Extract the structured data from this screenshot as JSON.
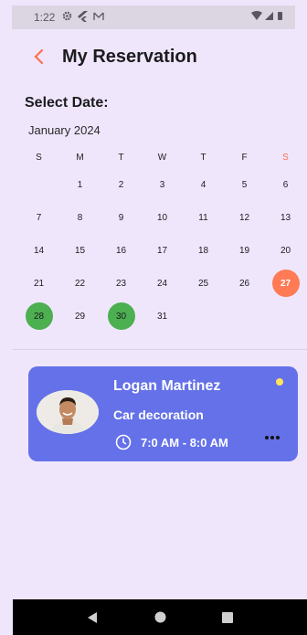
{
  "status_bar": {
    "time": "1:22",
    "icons": [
      "gear-icon",
      "flutter-icon",
      "mail-icon"
    ],
    "right_icons": [
      "wifi-icon",
      "signal-icon",
      "battery-icon"
    ]
  },
  "header": {
    "title": "My Reservation"
  },
  "calendar": {
    "label": "Select Date:",
    "month": "January 2024",
    "weekdays": [
      "S",
      "M",
      "T",
      "W",
      "T",
      "F",
      "S"
    ],
    "weeks": [
      [
        "",
        "1",
        "2",
        "3",
        "4",
        "5",
        "6"
      ],
      [
        "7",
        "8",
        "9",
        "10",
        "11",
        "12",
        "13"
      ],
      [
        "14",
        "15",
        "16",
        "17",
        "18",
        "19",
        "20"
      ],
      [
        "21",
        "22",
        "23",
        "24",
        "25",
        "26",
        "27"
      ],
      [
        "28",
        "29",
        "30",
        "31",
        "",
        "",
        ""
      ]
    ],
    "today": "27",
    "booked": [
      "28",
      "30"
    ],
    "colors": {
      "today": "#ff7a55",
      "booked": "#4caf50",
      "saturday_header": "#ff6f4e"
    }
  },
  "reservation": {
    "name": "Logan Martinez",
    "service": "Car decoration",
    "time": "7:0 AM - 8:0 AM",
    "card_color": "#6471e8",
    "status_color": "#ffe45c"
  },
  "nav": {
    "buttons": [
      "back-nav-icon",
      "home-nav-icon",
      "recents-nav-icon"
    ]
  }
}
